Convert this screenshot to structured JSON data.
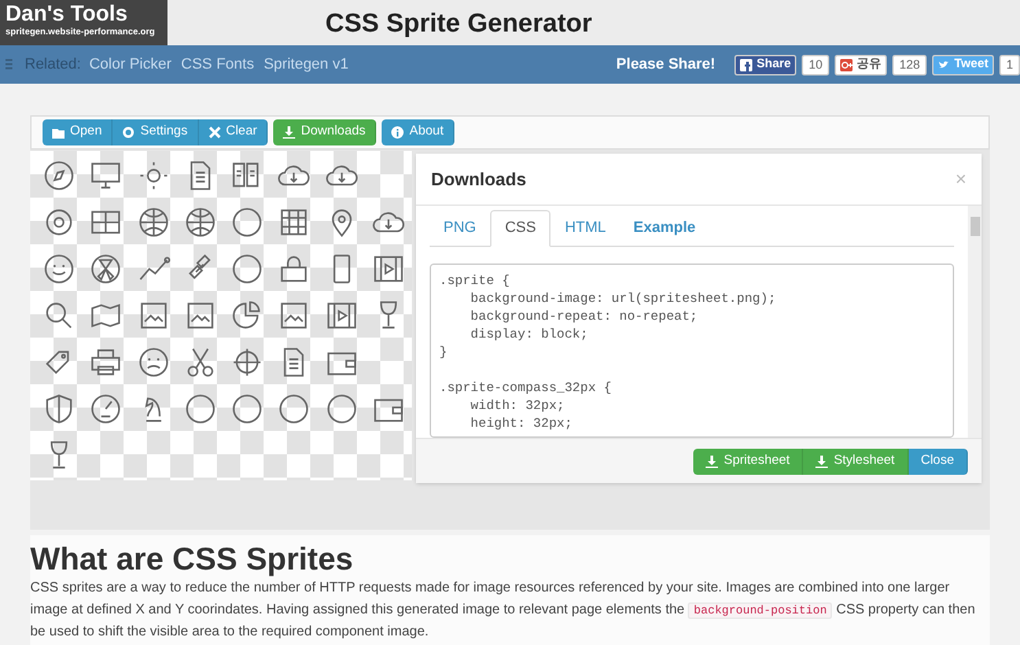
{
  "header": {
    "logo_title": "Dan's Tools",
    "logo_subtitle": "spritegen.website-performance.org",
    "page_title": "CSS Sprite Generator"
  },
  "nav": {
    "related_label": "Related:",
    "links": [
      "Color Picker",
      "CSS Fonts",
      "Spritegen v1"
    ],
    "share_label": "Please Share!",
    "share_buttons": [
      {
        "kind": "facebook",
        "label": "Share",
        "count": "10"
      },
      {
        "kind": "googleplus",
        "label": "공유",
        "count": "128"
      },
      {
        "kind": "twitter",
        "label": "Tweet",
        "count": "1"
      }
    ]
  },
  "toolbar": [
    {
      "kind": "folder",
      "label": "Open"
    },
    {
      "kind": "gear",
      "label": "Settings"
    },
    {
      "kind": "cross",
      "label": "Clear"
    },
    {
      "kind": "download",
      "label": "Downloads"
    },
    {
      "kind": "info",
      "label": "About"
    }
  ],
  "modal": {
    "title": "Downloads",
    "close": "×",
    "tabs": [
      {
        "kind": "tab",
        "label": "PNG",
        "selected": false
      },
      {
        "kind": "tab",
        "label": "CSS",
        "selected": true
      },
      {
        "kind": "tab",
        "label": "HTML",
        "selected": false
      },
      {
        "kind": "example",
        "label": "Example",
        "selected": false
      }
    ],
    "code": [
      [
        ".sprite {",
        "    background-image: url(spritesheet.png);",
        "    background-repeat: no-repeat;",
        "    display: block;",
        "}"
      ],
      [
        ".sprite-compass_32px {",
        "    width: 32px;",
        "    height: 32px;"
      ]
    ],
    "buttons": [
      {
        "kind": "download",
        "label": "Spritesheet"
      },
      {
        "kind": "download",
        "label": "Stylesheet"
      },
      {
        "kind": "plain",
        "label": "Close"
      }
    ]
  },
  "article": {
    "heading": "What are CSS Sprites",
    "before": "CSS sprites are a way to reduce the number of HTTP requests made for image resources referenced by your site. Images are combined into one larger image at defined X and Y coorindates. Having assigned this generated image to relevant page elements the",
    "code": "background-position",
    "after": "CSS property can then be used to shift the visible area to the required component image."
  }
}
